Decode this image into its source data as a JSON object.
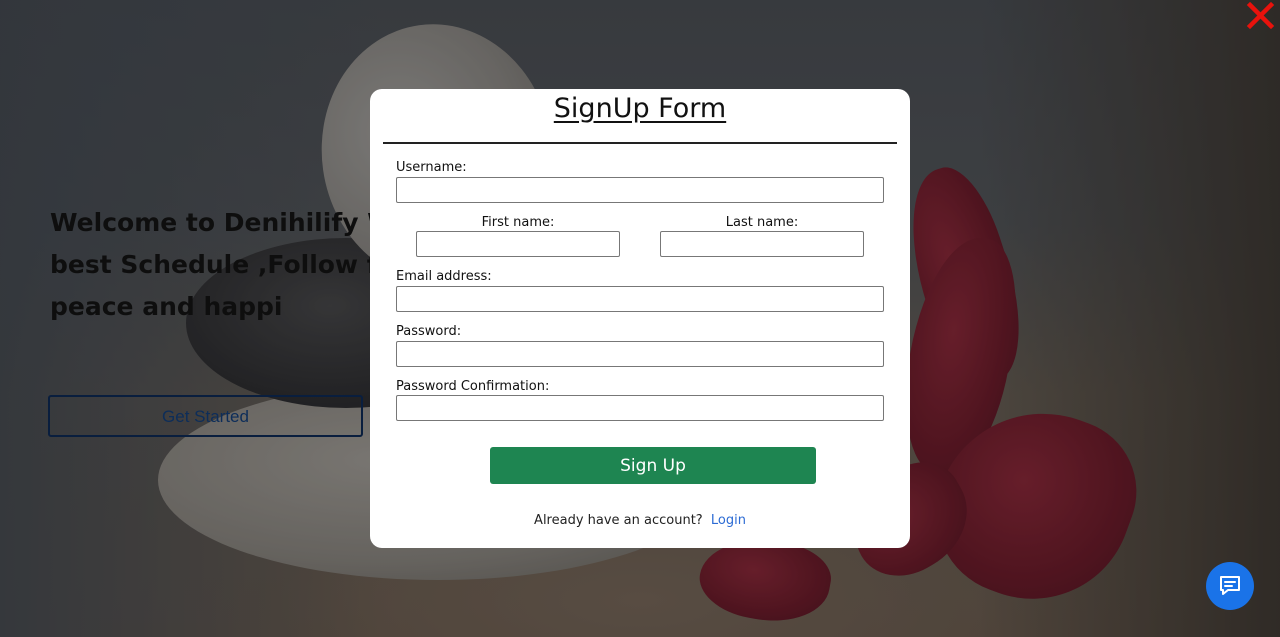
{
  "hero": {
    "heading": "Welcome to Denihilify W the best Schedule ,Follow feel the peace and happi",
    "cta_label": "Get Started"
  },
  "modal": {
    "title": "SignUp Form",
    "fields": {
      "username": {
        "label": "Username:",
        "value": ""
      },
      "first_name": {
        "label": "First name:",
        "value": ""
      },
      "last_name": {
        "label": "Last name:",
        "value": ""
      },
      "email": {
        "label": "Email address:",
        "value": ""
      },
      "password": {
        "label": "Password:",
        "value": ""
      },
      "password_confirmation": {
        "label": "Password Confirmation:",
        "value": ""
      }
    },
    "submit_label": "Sign Up",
    "login_prompt": "Already have an account?",
    "login_link": "Login"
  },
  "icons": {
    "close": "close-icon",
    "chat": "chat-icon"
  },
  "colors": {
    "close_icon": "#e8120c",
    "signup_button": "#1e8551",
    "login_link": "#2c6bd4",
    "chat_button": "#1a73e8"
  }
}
